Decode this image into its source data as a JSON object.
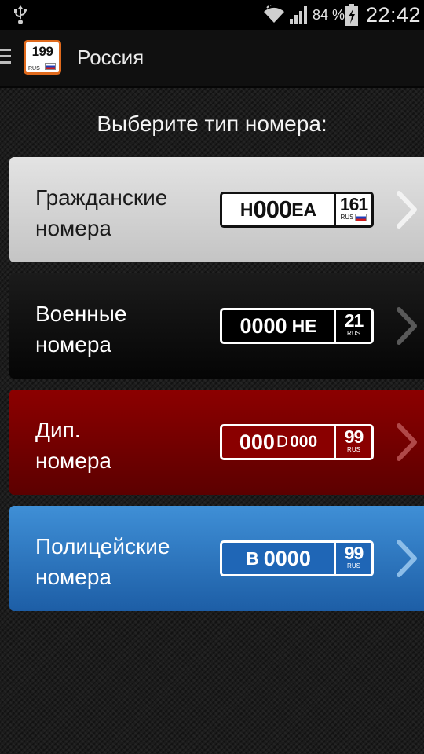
{
  "status_bar": {
    "battery_percent": "84 %",
    "time": "22:42",
    "icons": [
      "usb-icon",
      "wifi-icon",
      "signal-icon",
      "battery-charging-icon"
    ]
  },
  "action_bar": {
    "logo_number": "199",
    "logo_rus": "RUS",
    "title": "Россия",
    "icons": [
      "menu-icon",
      "app-logo-icon"
    ]
  },
  "prompt": "Выберите тип номера:",
  "cards": [
    {
      "label_line1": "Гражданские",
      "label_line2": "номера",
      "plate": {
        "p1": "Н",
        "p2": "000",
        "p3": "ЕА",
        "region": "161",
        "rus": "RUS",
        "flag": true
      },
      "background": "#d4d4d4"
    },
    {
      "label_line1": "Военные",
      "label_line2": "номера",
      "plate": {
        "p1": "0000",
        "p2": "НЕ",
        "region": "21",
        "rus": "RUS",
        "flag": false
      },
      "background": "#0d0d0d"
    },
    {
      "label_line1": "Дип.",
      "label_line2": "номера",
      "plate": {
        "p1": "000",
        "p2": "D",
        "p3": "000",
        "region": "99",
        "rus": "RUS",
        "flag": false
      },
      "background": "#7a0000"
    },
    {
      "label_line1": "Полицейские",
      "label_line2": "номера",
      "plate": {
        "p1": "В",
        "p2": "0000",
        "region": "99",
        "rus": "RUS",
        "flag": false
      },
      "background": "#2a78c4"
    }
  ],
  "colors": {
    "accent_logo": "#e06a1d",
    "plate_flag_white": "#ffffff",
    "plate_flag_blue": "#1c3fbf",
    "plate_flag_red": "#d01c1c"
  }
}
